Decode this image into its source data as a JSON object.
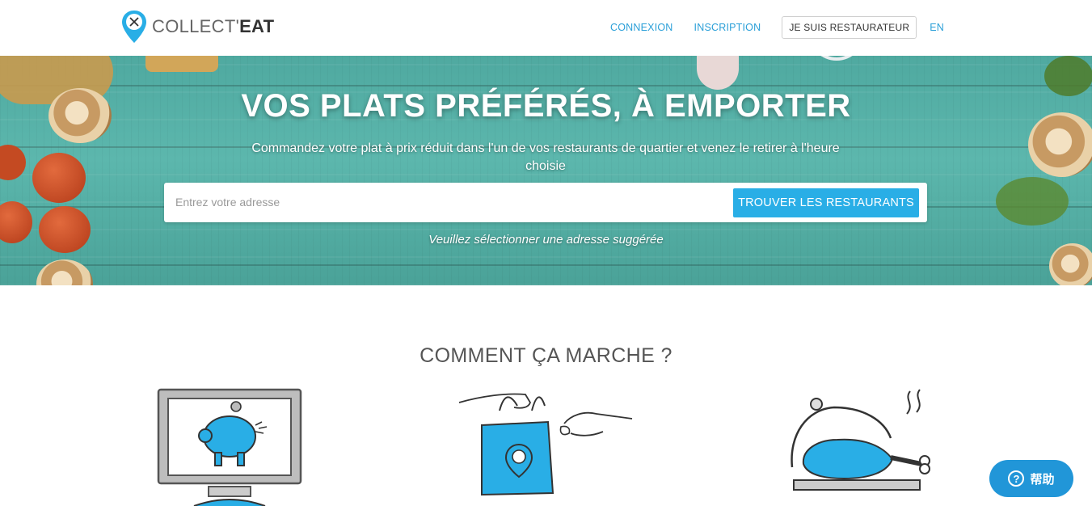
{
  "header": {
    "logo": {
      "text_light": "COLLECT'",
      "text_bold": "EAT"
    },
    "nav": {
      "login": "CONNEXION",
      "signup": "INSCRIPTION",
      "restaurateur": "JE SUIS RESTAURATEUR",
      "language": "EN"
    }
  },
  "hero": {
    "title": "VOS PLATS PRÉFÉRÉS, À EMPORTER",
    "subtitle": "Commandez votre plat à prix réduit dans l'un de vos restaurants de quartier et venez le retirer à l'heure choisie",
    "search": {
      "placeholder": "Entrez votre adresse",
      "value": "",
      "button": "TROUVER LES RESTAURANTS"
    },
    "hint": "Veuillez sélectionner une adresse suggérée"
  },
  "how_it_works": {
    "title": "COMMENT ÇA MARCHE ?",
    "steps": [
      {
        "icon": "computer-piggybank-icon"
      },
      {
        "icon": "shopping-bag-handover-icon"
      },
      {
        "icon": "serving-dish-chicken-icon"
      }
    ]
  },
  "help_widget": {
    "label": "帮助",
    "icon": "question-circle-icon"
  },
  "colors": {
    "accent": "#29aee6",
    "hero_bg": "#56b0a6",
    "help": "#2196d8"
  }
}
